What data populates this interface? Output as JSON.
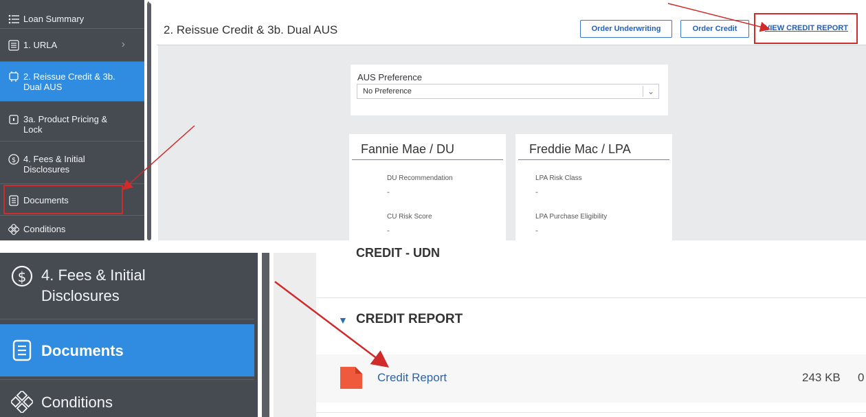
{
  "top": {
    "sidebar": {
      "items": [
        {
          "label": "Loan Summary",
          "icon": "list-icon"
        },
        {
          "label": "1. URLA",
          "icon": "form-icon",
          "chevron": "›"
        },
        {
          "label": "2. Reissue Credit & 3b. Dual AUS",
          "icon": "credit-icon",
          "active": true
        },
        {
          "label": "3a. Product Pricing & Lock",
          "icon": "lock-icon"
        },
        {
          "label": "4. Fees & Initial Disclosures",
          "icon": "dollar-icon"
        },
        {
          "label": "Documents",
          "icon": "document-icon"
        },
        {
          "label": "Conditions",
          "icon": "conditions-icon"
        }
      ]
    },
    "header": {
      "title": "2. Reissue Credit & 3b. Dual AUS",
      "order_underwriting": "Order Underwriting",
      "order_credit": "Order Credit",
      "view_credit_report": "VIEW CREDIT REPORT"
    },
    "aus": {
      "label": "AUS Preference",
      "value": "No Preference",
      "chevron": "⌄"
    },
    "fannie": {
      "title": "Fannie Mae / DU",
      "fields": [
        {
          "label": "DU Recommendation",
          "value": "-"
        },
        {
          "label": "CU Risk Score",
          "value": "-"
        }
      ]
    },
    "freddie": {
      "title": "Freddie Mac / LPA",
      "fields": [
        {
          "label": "LPA Risk Class",
          "value": "-"
        },
        {
          "label": "LPA Purchase Eligibility",
          "value": "-"
        }
      ]
    }
  },
  "bottom": {
    "sidebar": {
      "items": [
        {
          "label": "4. Fees & Initial Disclosures",
          "icon": "dollar-icon"
        },
        {
          "label": "Documents",
          "icon": "document-icon",
          "active": true
        },
        {
          "label": "Conditions",
          "icon": "conditions-icon"
        }
      ]
    },
    "section_cut": "CREDIT - UDN",
    "section": {
      "title": "CREDIT REPORT",
      "toggle": "▼"
    },
    "document": {
      "name": "Credit Report",
      "size": "243 KB",
      "trail": "0"
    }
  },
  "colors": {
    "sidebar_bg": "#464b52",
    "active_blue": "#2f8ce0",
    "annotation_red": "#d02a2a",
    "pdf_red": "#f05a3c"
  }
}
